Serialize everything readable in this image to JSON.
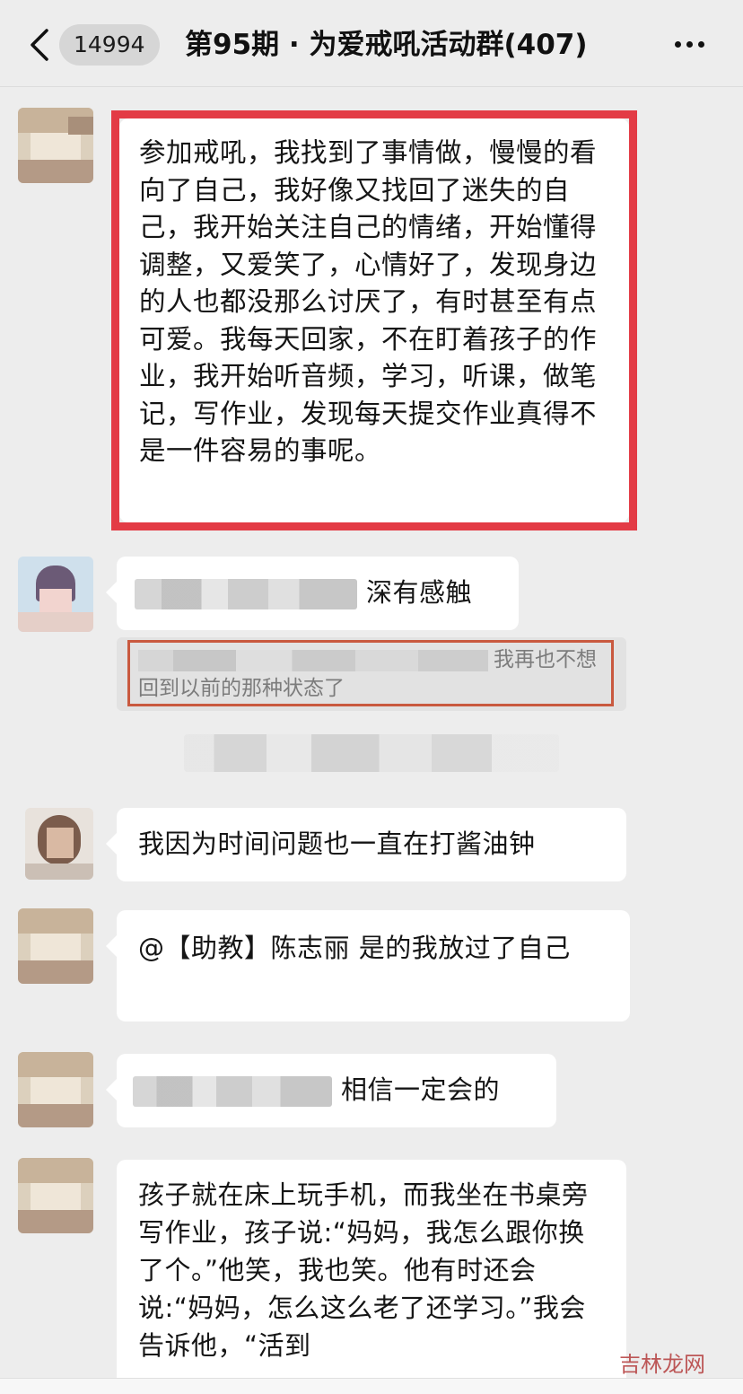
{
  "header": {
    "unread_count": "14994",
    "title": "第95期 · 为爱戒吼活动群(407)"
  },
  "messages": {
    "m1": "参加戒吼，我找到了事情做，慢慢的看向了自己，我好像又找回了迷失的自己，我开始关注自己的情绪，开始懂得调整，又爱笑了，心情好了，发现身边的人也都没那么讨厌了，有时甚至有点可爱。我每天回家，不在盯着孩子的作业，我开始听音频，学习，听课，做笔记，写作业，发现每天提交作业真得不是一件容易的事呢。",
    "m2": "深有感触",
    "m2_quote": "我再也不想回到以前的那种状态了",
    "m3": "我因为时间问题也一直在打酱油钟",
    "m4": "@【助教】陈志丽 是的我放过了自己",
    "m5": "相信一定会的",
    "m6": "孩子就在床上玩手机，而我坐在书桌旁写作业，孩子说:“妈妈，我怎么跟你换了个。”他笑，我也笑。他有时还会说:“妈妈，怎么这么老了还学习。”我会告诉他，“活到"
  },
  "watermark": "吉林龙网",
  "colors": {
    "highlight_frame": "#e33b45",
    "quote_frame": "#c9593f",
    "chat_background": "#ededed",
    "bubble": "#ffffff"
  }
}
